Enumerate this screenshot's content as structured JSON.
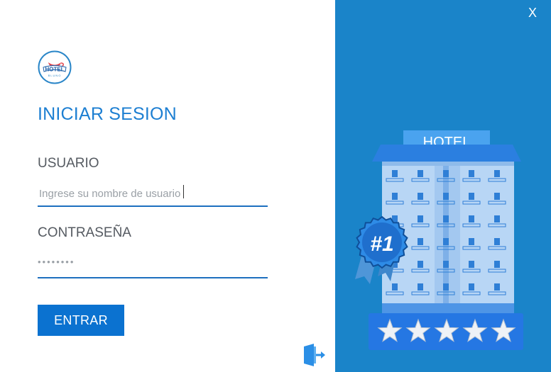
{
  "window": {
    "close_label": "X",
    "accent": "#1a84c9"
  },
  "logo": {
    "icon": "hotel-logo-icon",
    "text": "HOTEL",
    "subtext": "BLUNO"
  },
  "login": {
    "title": "INICIAR SESION",
    "username_label": "USUARIO",
    "username_placeholder": "Ingrese su nombre de usuario",
    "password_label": "CONTRASEÑA",
    "password_value": "••••••••",
    "submit_label": "ENTRAR"
  },
  "exit": {
    "icon": "exit-door-icon"
  },
  "illustration": {
    "sign_text": "HOTEL",
    "badge_text": "#1",
    "stars_count": 5
  }
}
